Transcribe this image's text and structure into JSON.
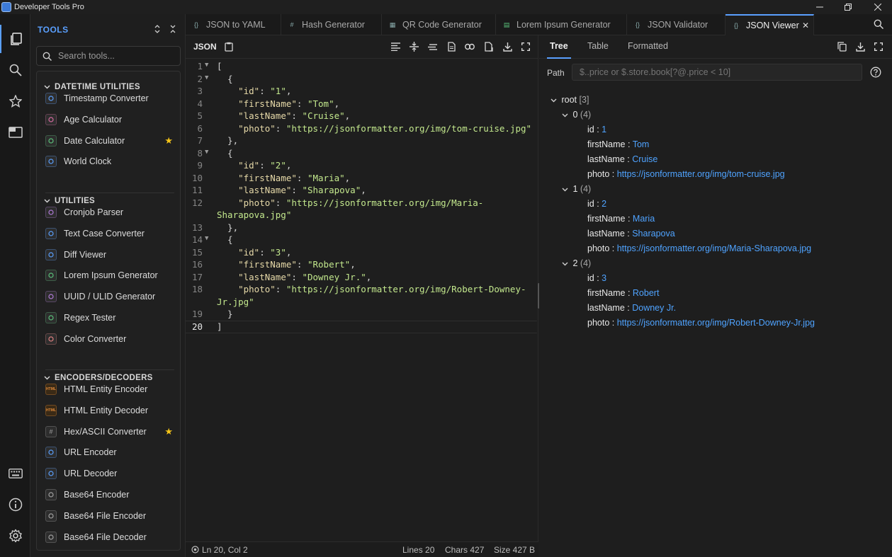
{
  "window": {
    "title": "Developer Tools Pro"
  },
  "sidebar": {
    "heading": "TOOLS",
    "search_placeholder": "Search tools...",
    "categories": [
      {
        "label": "DATETIME UTILITIES",
        "tools": [
          {
            "label": "Timestamp Converter",
            "icon": "clock-icon",
            "color": "#5aa0ff"
          },
          {
            "label": "Age Calculator",
            "icon": "calendar-icon",
            "color": "#d66aa0"
          },
          {
            "label": "Date Calculator",
            "icon": "calendar-edit-icon",
            "color": "#5ac07a",
            "starred": true
          },
          {
            "label": "World Clock",
            "icon": "globe-icon",
            "color": "#5aa0ff"
          }
        ]
      },
      {
        "label": "UTILITIES",
        "tools": [
          {
            "label": "Cronjob Parser",
            "icon": "clock-icon",
            "color": "#b07ad8"
          },
          {
            "label": "Text Case Converter",
            "icon": "text-case-icon",
            "color": "#5aa0ff"
          },
          {
            "label": "Diff Viewer",
            "icon": "diff-icon",
            "color": "#5aa0ff"
          },
          {
            "label": "Lorem Ipsum Generator",
            "icon": "document-icon",
            "color": "#5ac07a"
          },
          {
            "label": "UUID / ULID Generator",
            "icon": "fingerprint-icon",
            "color": "#b07ad8"
          },
          {
            "label": "Regex Tester",
            "icon": "search-icon",
            "color": "#5ac07a"
          },
          {
            "label": "Color Converter",
            "icon": "palette-icon",
            "color": "#e08080"
          }
        ]
      },
      {
        "label": "ENCODERS/DECODERS",
        "tools": [
          {
            "label": "HTML Entity Encoder",
            "icon": "html-icon",
            "color": "#e08a3a",
            "glyph": "HTML"
          },
          {
            "label": "HTML Entity Decoder",
            "icon": "html-icon",
            "color": "#e08a3a",
            "glyph": "HTML"
          },
          {
            "label": "Hex/ASCII Converter",
            "icon": "hash-icon",
            "color": "#a0a0a0",
            "glyph": "#",
            "starred": true
          },
          {
            "label": "URL Encoder",
            "icon": "link-icon",
            "color": "#5aa0ff"
          },
          {
            "label": "URL Decoder",
            "icon": "link-off-icon",
            "color": "#5aa0ff"
          },
          {
            "label": "Base64 Encoder",
            "icon": "shield-icon",
            "color": "#a0a0a0"
          },
          {
            "label": "Base64 File Encoder",
            "icon": "file-icon",
            "color": "#a0a0a0"
          },
          {
            "label": "Base64 File Decoder",
            "icon": "download-icon",
            "color": "#a0a0a0"
          }
        ]
      }
    ]
  },
  "tabs": [
    {
      "label": "JSON to YAML",
      "icon": "braces-icon"
    },
    {
      "label": "Hash Generator",
      "icon": "hash-icon"
    },
    {
      "label": "QR Code Generator",
      "icon": "qr-icon"
    },
    {
      "label": "Lorem Ipsum Generator",
      "icon": "document-icon"
    },
    {
      "label": "JSON Validator",
      "icon": "braces-icon"
    },
    {
      "label": "JSON Viewer",
      "icon": "braces-icon",
      "active": true
    }
  ],
  "editor": {
    "label": "JSON",
    "lines": [
      {
        "n": "1",
        "fold": true,
        "parts": [
          [
            "p",
            "["
          ]
        ]
      },
      {
        "n": "2",
        "fold": true,
        "parts": [
          [
            "p",
            "  {"
          ]
        ]
      },
      {
        "n": "3",
        "parts": [
          [
            "p",
            "    "
          ],
          [
            "k",
            "\"id\""
          ],
          [
            "p",
            ": "
          ],
          [
            "s",
            "\"1\""
          ],
          [
            "p",
            ","
          ]
        ]
      },
      {
        "n": "4",
        "parts": [
          [
            "p",
            "    "
          ],
          [
            "k",
            "\"firstName\""
          ],
          [
            "p",
            ": "
          ],
          [
            "s",
            "\"Tom\""
          ],
          [
            "p",
            ","
          ]
        ]
      },
      {
        "n": "5",
        "parts": [
          [
            "p",
            "    "
          ],
          [
            "k",
            "\"lastName\""
          ],
          [
            "p",
            ": "
          ],
          [
            "s",
            "\"Cruise\""
          ],
          [
            "p",
            ","
          ]
        ]
      },
      {
        "n": "6",
        "parts": [
          [
            "p",
            "    "
          ],
          [
            "k",
            "\"photo\""
          ],
          [
            "p",
            ": "
          ],
          [
            "s",
            "\"https://jsonformatter.org/img/tom-cruise.jpg\""
          ]
        ]
      },
      {
        "n": "7",
        "parts": [
          [
            "p",
            "  },"
          ]
        ]
      },
      {
        "n": "8",
        "fold": true,
        "parts": [
          [
            "p",
            "  {"
          ]
        ]
      },
      {
        "n": "9",
        "parts": [
          [
            "p",
            "    "
          ],
          [
            "k",
            "\"id\""
          ],
          [
            "p",
            ": "
          ],
          [
            "s",
            "\"2\""
          ],
          [
            "p",
            ","
          ]
        ]
      },
      {
        "n": "10",
        "parts": [
          [
            "p",
            "    "
          ],
          [
            "k",
            "\"firstName\""
          ],
          [
            "p",
            ": "
          ],
          [
            "s",
            "\"Maria\""
          ],
          [
            "p",
            ","
          ]
        ]
      },
      {
        "n": "11",
        "parts": [
          [
            "p",
            "    "
          ],
          [
            "k",
            "\"lastName\""
          ],
          [
            "p",
            ": "
          ],
          [
            "s",
            "\"Sharapova\""
          ],
          [
            "p",
            ","
          ]
        ]
      },
      {
        "n": "12",
        "parts": [
          [
            "p",
            "    "
          ],
          [
            "k",
            "\"photo\""
          ],
          [
            "p",
            ": "
          ],
          [
            "s",
            "\"https://jsonformatter.org/img/Maria-"
          ]
        ]
      },
      {
        "n": "",
        "parts": [
          [
            "s",
            "Sharapova.jpg\""
          ]
        ]
      },
      {
        "n": "13",
        "parts": [
          [
            "p",
            "  },"
          ]
        ]
      },
      {
        "n": "14",
        "fold": true,
        "parts": [
          [
            "p",
            "  {"
          ]
        ]
      },
      {
        "n": "15",
        "parts": [
          [
            "p",
            "    "
          ],
          [
            "k",
            "\"id\""
          ],
          [
            "p",
            ": "
          ],
          [
            "s",
            "\"3\""
          ],
          [
            "p",
            ","
          ]
        ]
      },
      {
        "n": "16",
        "parts": [
          [
            "p",
            "    "
          ],
          [
            "k",
            "\"firstName\""
          ],
          [
            "p",
            ": "
          ],
          [
            "s",
            "\"Robert\""
          ],
          [
            "p",
            ","
          ]
        ]
      },
      {
        "n": "17",
        "parts": [
          [
            "p",
            "    "
          ],
          [
            "k",
            "\"lastName\""
          ],
          [
            "p",
            ": "
          ],
          [
            "s",
            "\"Downey Jr.\""
          ],
          [
            "p",
            ","
          ]
        ]
      },
      {
        "n": "18",
        "parts": [
          [
            "p",
            "    "
          ],
          [
            "k",
            "\"photo\""
          ],
          [
            "p",
            ": "
          ],
          [
            "s",
            "\"https://jsonformatter.org/img/Robert-Downey-"
          ]
        ]
      },
      {
        "n": "",
        "parts": [
          [
            "s",
            "Jr.jpg\""
          ]
        ]
      },
      {
        "n": "19",
        "parts": [
          [
            "p",
            "  }"
          ]
        ]
      },
      {
        "n": "20",
        "current": true,
        "parts": [
          [
            "p",
            "]"
          ]
        ]
      }
    ]
  },
  "status": {
    "position": "Ln 20, Col 2",
    "lines": "Lines 20",
    "chars": "Chars 427",
    "size": "Size 427 B"
  },
  "viewer": {
    "tabs": [
      "Tree",
      "Table",
      "Formatted"
    ],
    "active_tab": "Tree",
    "path_label": "Path",
    "path_placeholder": "$..price or $.store.book[?@.price < 10]",
    "root": {
      "key": "root",
      "count": "[3]"
    },
    "items": [
      {
        "index": "0",
        "count": "(4)",
        "fields": [
          {
            "key": "id",
            "value": "1"
          },
          {
            "key": "firstName",
            "value": "Tom"
          },
          {
            "key": "lastName",
            "value": "Cruise"
          },
          {
            "key": "photo",
            "value": "https://jsonformatter.org/img/tom-cruise.jpg"
          }
        ]
      },
      {
        "index": "1",
        "count": "(4)",
        "fields": [
          {
            "key": "id",
            "value": "2"
          },
          {
            "key": "firstName",
            "value": "Maria"
          },
          {
            "key": "lastName",
            "value": "Sharapova"
          },
          {
            "key": "photo",
            "value": "https://jsonformatter.org/img/Maria-Sharapova.jpg"
          }
        ]
      },
      {
        "index": "2",
        "count": "(4)",
        "fields": [
          {
            "key": "id",
            "value": "3"
          },
          {
            "key": "firstName",
            "value": "Robert"
          },
          {
            "key": "lastName",
            "value": "Downey Jr."
          },
          {
            "key": "photo",
            "value": "https://jsonformatter.org/img/Robert-Downey-Jr.jpg"
          }
        ]
      }
    ]
  }
}
